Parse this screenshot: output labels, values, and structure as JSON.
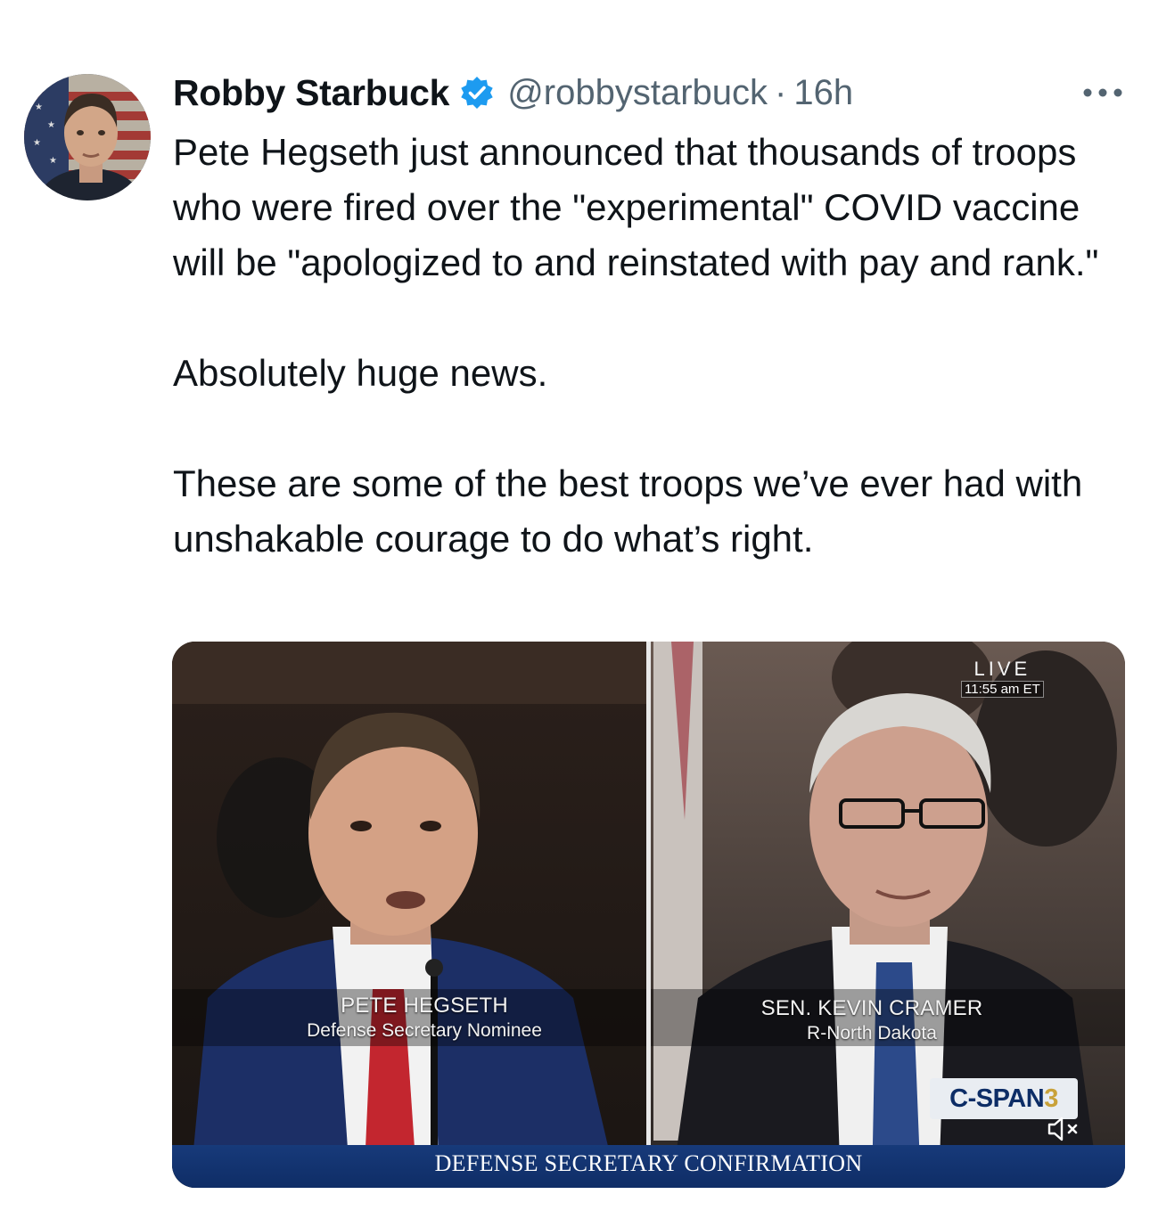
{
  "author": {
    "name": "Robby Starbuck",
    "handle": "@robbystarbuck",
    "separator": "·",
    "time": "16h"
  },
  "icons": {
    "verified": "verified-badge-icon",
    "more": "more-icon",
    "mute": "muted-speaker-icon"
  },
  "colors": {
    "verified_blue": "#1d9bf0",
    "secondary_text": "#536471",
    "banner_blue": "#173a7a"
  },
  "tweet": {
    "paragraphs": [
      "Pete Hegseth just announced that thousands of troops who were fired over the \"experimental\" COVID vaccine will be \"apologized to and reinstated with pay and rank.\"",
      "Absolutely huge news.",
      "These are some of the best troops we’ve ever had with unshakable courage to do what’s right."
    ]
  },
  "video": {
    "live_label": "LIVE",
    "live_time": "11:55 am ET",
    "left_name": "PETE HEGSETH",
    "left_title": "Defense Secretary Nominee",
    "right_name": "SEN. KEVIN CRAMER",
    "right_title": "R-North Dakota",
    "network_main": "C-SPAN",
    "network_number": "3",
    "banner": "DEFENSE SECRETARY CONFIRMATION"
  }
}
